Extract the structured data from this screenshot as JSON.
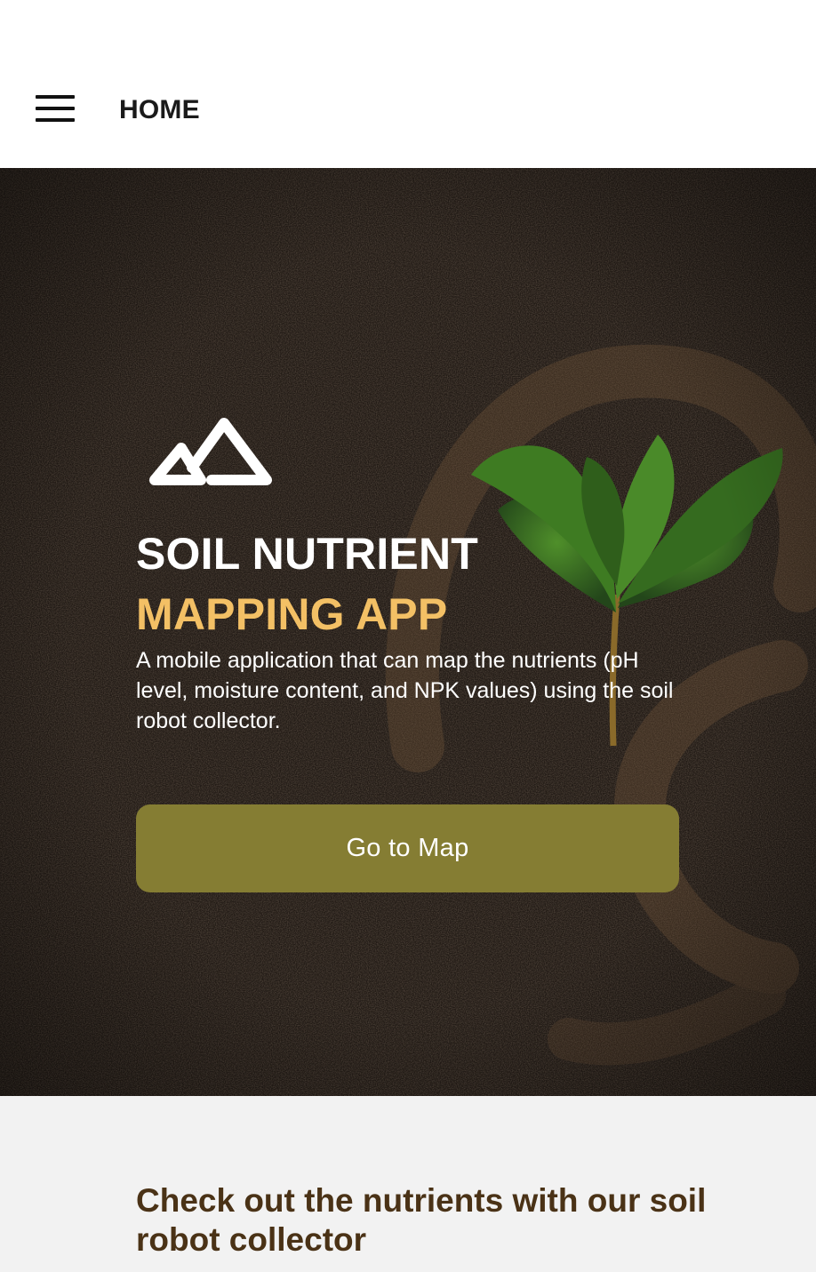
{
  "header": {
    "title": "HOME",
    "menu_icon": "hamburger-menu-icon"
  },
  "hero": {
    "logo_icon": "mountain-icon",
    "title_line1": "SOIL NUTRIENT",
    "title_line2": "MAPPING APP",
    "description": "A mobile application that can map the nutrients (pH level, moisture content, and NPK values) using the soil robot collector.",
    "cta_label": "Go to Map",
    "accent_color": "#f3c065",
    "button_color": "#857d33",
    "background_image": "soil-with-seedling"
  },
  "info": {
    "heading": "Check out the nutrients with our soil robot collector",
    "heading_color": "#4a3216"
  }
}
